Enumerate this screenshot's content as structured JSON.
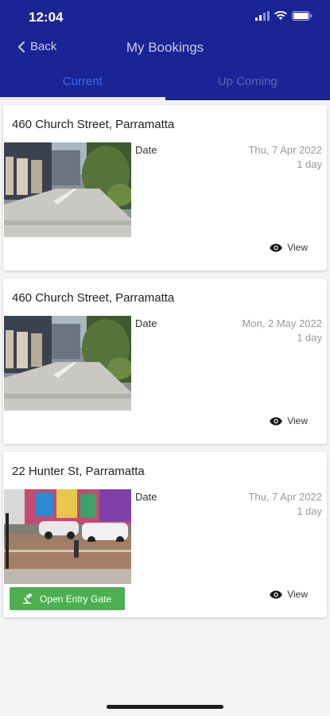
{
  "status_bar": {
    "time": "12:04"
  },
  "nav": {
    "back_label": "Back",
    "title": "My Bookings"
  },
  "tabs": [
    {
      "label": "Current",
      "active": true
    },
    {
      "label": "Up Coming",
      "active": false
    }
  ],
  "bookings": [
    {
      "address": "460 Church Street, Parramatta",
      "date_label": "Date",
      "date": "Thu, 7 Apr 2022",
      "duration": "1 day",
      "view_label": "View",
      "image": "driveway-photo"
    },
    {
      "address": "460 Church Street, Parramatta",
      "date_label": "Date",
      "date": "Mon, 2 May 2022",
      "duration": "1 day",
      "view_label": "View",
      "image": "driveway-photo"
    },
    {
      "address": "22 Hunter St, Parramatta",
      "date_label": "Date",
      "date": "Thu, 7 Apr 2022",
      "duration": "1 day",
      "view_label": "View",
      "image": "car-park-mural-photo",
      "gate_button_label": "Open Entry Gate"
    }
  ],
  "colors": {
    "header": "#1a2494",
    "active_tab": "#3a6cf0",
    "gate_button": "#4cb050"
  }
}
